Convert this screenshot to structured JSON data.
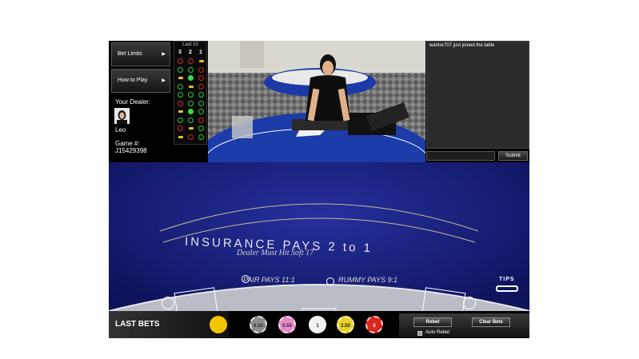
{
  "sidebar": {
    "bet_limits_label": "Bet Limits",
    "how_to_play_label": "How to Play",
    "your_dealer_label": "Your Dealer:",
    "dealer_name": "Leo",
    "game_label": "Game #:",
    "game_number": "J15429398"
  },
  "last10": {
    "title": "Last 10",
    "headers": [
      "3",
      "2",
      "1"
    ]
  },
  "chat": {
    "messages": [
      "wantor707 just joined the table"
    ],
    "input_value": "",
    "submit_label": "Submit"
  },
  "table_text": {
    "dealer_rule": "Dealer Must Hit Soft 17",
    "insurance": "INSURANCE PAYS 2 to 1",
    "pair_pays": "PAIR PAYS 11:1",
    "rummy_pays": "RUMMY PAYS 9:1",
    "tips": "TIPS",
    "table_logo": "INSURANCE PAYS 2 to 1"
  },
  "bottom": {
    "last_bets_label": "LAST BETS",
    "chips": [
      {
        "label": "0.10",
        "color": "#8c8c8c"
      },
      {
        "label": "0.50",
        "color": "#e58ac8"
      },
      {
        "label": "1",
        "color": "#f2f2f2"
      },
      {
        "label": "2.50",
        "color": "#e8d22a"
      },
      {
        "label": "5",
        "color": "#d6261f"
      }
    ],
    "rebet_label": "Rebet",
    "clear_bets_label": "Clear Bets",
    "auto_rebet_label": "Auto Rebet"
  },
  "colors": {
    "felt": "#161a6e",
    "felt_center": "#1f2a9a",
    "rail": "#b9bdc6",
    "chip_green": "#29c83b",
    "chip_red": "#d3252b"
  }
}
